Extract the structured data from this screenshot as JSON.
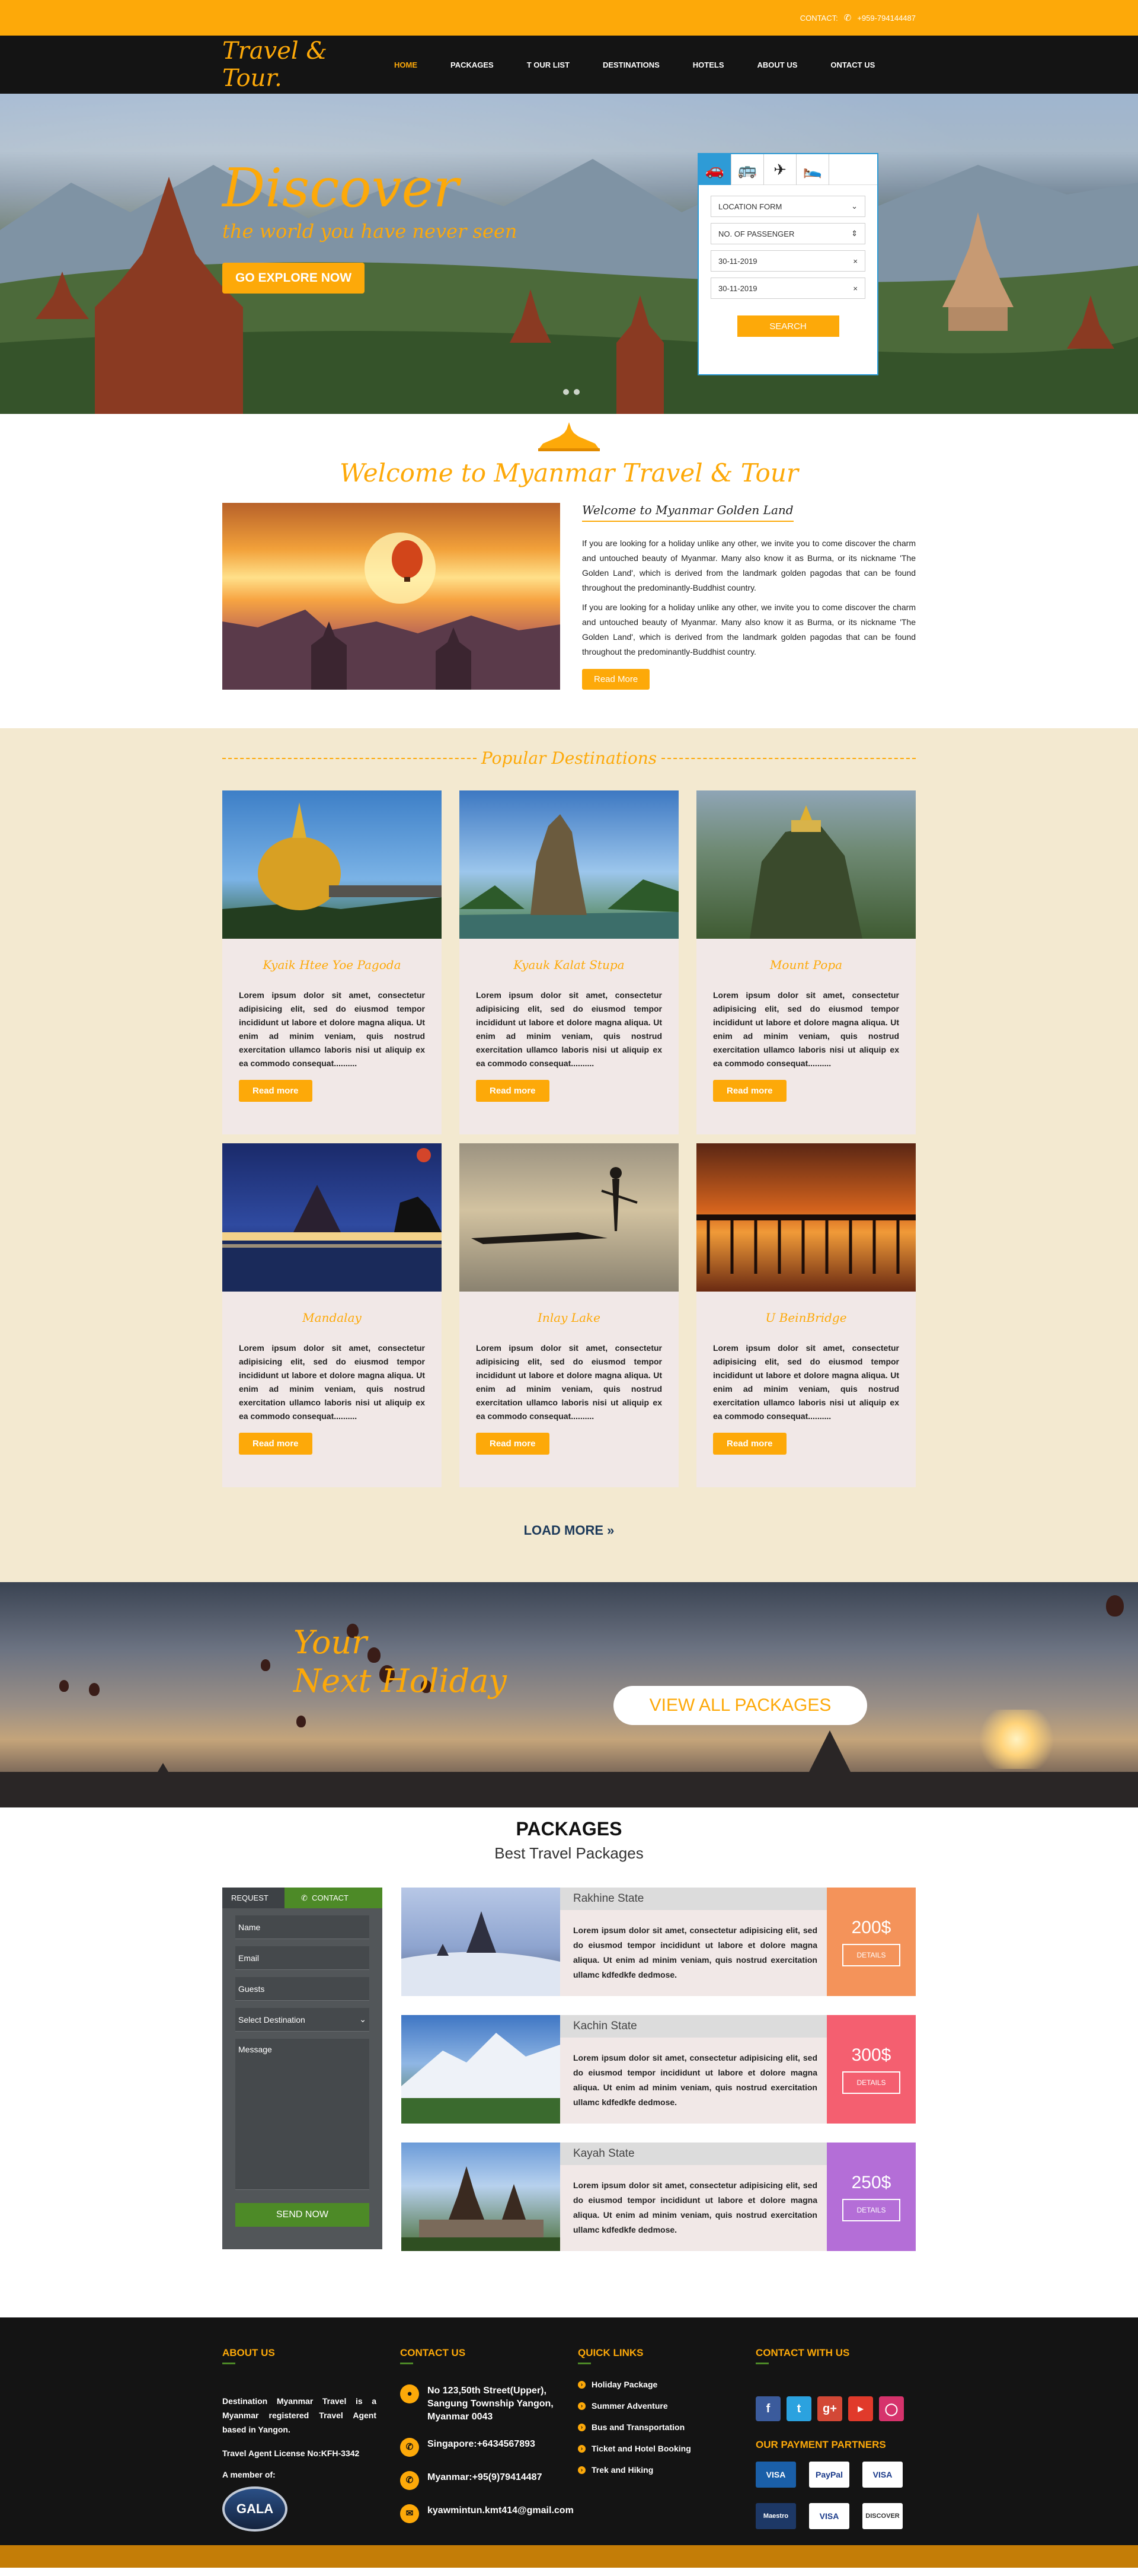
{
  "topbar": {
    "contact_label": "CONTACT:",
    "phone": "+959-794144487"
  },
  "nav": {
    "logo": "Travel & Tour.",
    "items": [
      {
        "label": "HOME",
        "active": true
      },
      {
        "label": "PACKAGES"
      },
      {
        "label": "T OUR LIST"
      },
      {
        "label": "DESTINATIONS"
      },
      {
        "label": "HOTELS"
      },
      {
        "label": "ABOUT US"
      },
      {
        "label": "ONTACT US"
      }
    ]
  },
  "hero": {
    "title": "Discover",
    "subtitle": "the world you have never seen",
    "cta": "GO EXPLORE NOW",
    "search": {
      "tabs": [
        "car-icon",
        "bus-icon",
        "plane-icon",
        "bed-icon"
      ],
      "location_form": "LOCATION FORM",
      "passengers": "NO. OF PASSENGER",
      "date_from": "30-11-2019",
      "date_to": "30-11-2019",
      "button": "SEARCH"
    }
  },
  "welcome": {
    "title": "Welcome to Myanmar Travel & Tour",
    "subtitle": "Welcome to Myanmar Golden Land",
    "p1": "If you are looking for a holiday unlike any other, we invite you to come discover the charm and untouched beauty of Myanmar. Many also know it as Burma, or its nickname 'The Golden Land', which is derived from the landmark golden pagodas that can be found throughout the predominantly-Buddhist country.",
    "p2": "If you are looking for a holiday unlike any other, we invite you to come discover the charm and untouched beauty of Myanmar. Many also know it as Burma, or its nickname 'The Golden Land', which is derived from the landmark golden pagodas that can be found throughout the predominantly-Buddhist country.",
    "button": "Read More"
  },
  "destinations": {
    "heading": "Popular Destinations",
    "cards": [
      {
        "title": "Kyaik Htee Yoe Pagoda",
        "text": "Lorem ipsum dolor sit amet, consectetur adipisicing elit, sed do eiusmod tempor incididunt ut labore et dolore magna aliqua. Ut enim ad minim veniam, quis nostrud exercitation ullamco laboris nisi ut aliquip ex ea commodo consequat..........",
        "button": "Read more"
      },
      {
        "title": "Kyauk Kalat Stupa",
        "text": "Lorem ipsum dolor sit amet, consectetur adipisicing elit, sed do eiusmod tempor incididunt ut labore et dolore magna aliqua. Ut enim ad minim veniam, quis nostrud exercitation ullamco laboris nisi ut aliquip ex ea commodo consequat..........",
        "button": "Read more"
      },
      {
        "title": "Mount Popa",
        "text": "Lorem ipsum dolor sit amet, consectetur adipisicing elit, sed do eiusmod tempor incididunt ut labore et dolore magna aliqua. Ut enim ad minim veniam, quis nostrud exercitation ullamco laboris nisi ut aliquip ex ea commodo consequat..........",
        "button": "Read more"
      },
      {
        "title": "Mandalay",
        "text": "Lorem ipsum dolor sit amet, consectetur adipisicing elit, sed do eiusmod tempor incididunt ut labore et dolore magna aliqua. Ut enim ad minim veniam, quis nostrud exercitation ullamco laboris nisi ut aliquip ex ea commodo consequat..........",
        "button": "Read more"
      },
      {
        "title": "Inlay Lake",
        "text": "Lorem ipsum dolor sit amet, consectetur adipisicing elit, sed do eiusmod tempor incididunt ut labore et dolore magna aliqua. Ut enim ad minim veniam, quis nostrud exercitation ullamco laboris nisi ut aliquip ex ea commodo consequat..........",
        "button": "Read more"
      },
      {
        "title": "U BeinBridge",
        "text": "Lorem ipsum dolor sit amet, consectetur adipisicing elit, sed do eiusmod tempor incididunt ut labore et dolore magna aliqua. Ut enim ad minim veniam, quis nostrud exercitation ullamco laboris nisi ut aliquip ex ea commodo consequat..........",
        "button": "Read more"
      }
    ],
    "load_more": "LOAD MORE"
  },
  "holiday": {
    "line1": "Your",
    "line2": "Next Holiday",
    "button": "VIEW ALL PACKAGES"
  },
  "packages": {
    "title": "PACKAGES",
    "subtitle": "Best Travel Packages",
    "form": {
      "tab_request": "REQUEST",
      "tab_contact": "CONTACT",
      "name": "Name",
      "email": "Email",
      "guests": "Guests",
      "destination": "Select Destination",
      "message": "Message",
      "send": "SEND NOW"
    },
    "items": [
      {
        "title": "Rakhine State",
        "text": "Lorem ipsum dolor sit amet, consectetur adipisicing elit, sed do eiusmod tempor incididunt ut labore et dolore magna aliqua. Ut enim ad minim veniam, quis nostrud exercitation ullamc kdfedkfe dedmose.",
        "price": "200$",
        "details": "DETAILS",
        "color": "#f4935a"
      },
      {
        "title": "Kachin State",
        "text": "Lorem ipsum dolor sit amet, consectetur adipisicing elit, sed do eiusmod tempor incididunt ut labore et dolore magna aliqua. Ut enim ad minim veniam, quis nostrud exercitation ullamc kdfedkfe dedmose.",
        "price": "300$",
        "details": "DETAILS",
        "color": "#f45f70"
      },
      {
        "title": "Kayah State",
        "text": "Lorem ipsum dolor sit amet, consectetur adipisicing elit, sed do eiusmod tempor incididunt ut labore et dolore magna aliqua. Ut enim ad minim veniam, quis nostrud exercitation ullamc kdfedkfe dedmose.",
        "price": "250$",
        "details": "DETAILS",
        "color": "#b46ed7"
      }
    ]
  },
  "footer": {
    "about": {
      "heading": "ABOUT US",
      "text": "Destination Myanmar Travel is a Myanmar registered Travel Agent based in Yangon.",
      "license": "Travel Agent License No:KFH-3342",
      "member": "A member of:",
      "gala": "GALA"
    },
    "contact": {
      "heading": "CONTACT US",
      "address": "No 123,50th Street(Upper), Sangung Township Yangon, Myanmar 0043",
      "singapore": "Singapore:+6434567893",
      "myanmar": "Myanmar:+95(9)79414487",
      "email": "kyawmintun.kmt414@gmail.com"
    },
    "quick": {
      "heading": "QUICK LINKS",
      "links": [
        "Holiday Package",
        "Summer Adventure",
        "Bus and Transportation",
        "Ticket and Hotel Booking",
        "Trek and Hiking"
      ]
    },
    "social": {
      "heading": "CONTACT WITH US",
      "payments_heading": "OUR PAYMENT PARTNERS",
      "payments": [
        "VISA",
        "PayPal",
        "VISA",
        "Maestro",
        "VISA",
        "DISCOVER"
      ]
    }
  }
}
